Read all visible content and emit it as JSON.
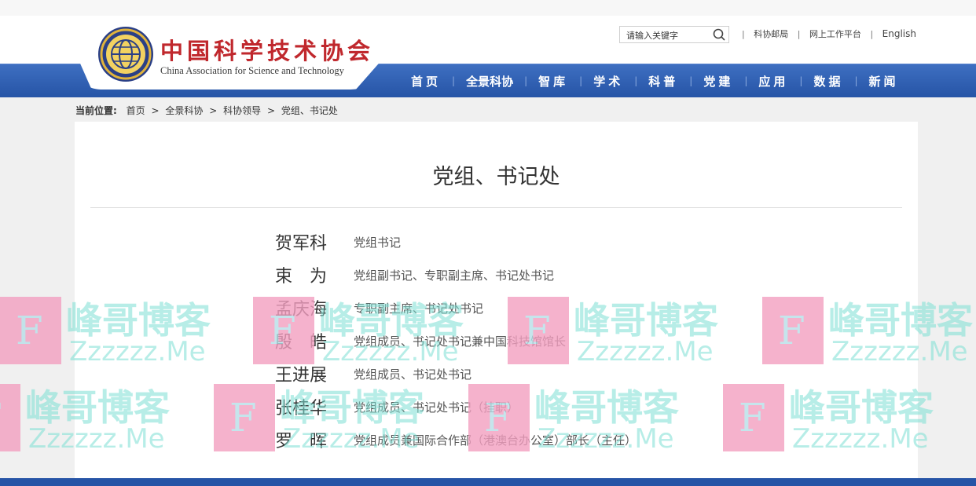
{
  "header": {
    "logo_cn": "中国科学技术协会",
    "logo_en": "China Association for Science and Technology",
    "search_placeholder": "请输入关键字",
    "links": [
      "科协邮局",
      "网上工作平台",
      "English"
    ]
  },
  "nav": [
    "首页",
    "全景科协",
    "智库",
    "学术",
    "科普",
    "党建",
    "应用",
    "数据",
    "新闻"
  ],
  "breadcrumb": {
    "label": "当前位置:",
    "items": [
      "首页",
      "全景科协",
      "科协领导",
      "党组、书记处"
    ],
    "sep": ">"
  },
  "main": {
    "title": "党组、书记处",
    "people": [
      {
        "name": "贺军科",
        "title": "党组书记"
      },
      {
        "name": "束　为",
        "title": "党组副书记、专职副主席、书记处书记"
      },
      {
        "name": "孟庆海",
        "title": "专职副主席、书记处书记"
      },
      {
        "name": "殷　皓",
        "title": "党组成员、书记处书记兼中国科技馆馆长"
      },
      {
        "name": "王进展",
        "title": "党组成员、书记处书记"
      },
      {
        "name": "张桂华",
        "title": "党组成员、书记处书记（挂职）"
      },
      {
        "name": "罗　晖",
        "title": "党组成员兼国际合作部（港澳台办公室）部长（主任）"
      }
    ]
  },
  "watermark": {
    "letter": "F",
    "text1": "峰哥博客",
    "text2": "Zzzzzz.Me"
  },
  "colors": {
    "nav_blue": "#2654a6",
    "logo_red": "#c0282d",
    "watermark_pink": "#f39fc0",
    "watermark_teal": "#7de0d4"
  },
  "icons": {
    "search": "search-icon",
    "emblem": "cast-emblem-icon"
  }
}
